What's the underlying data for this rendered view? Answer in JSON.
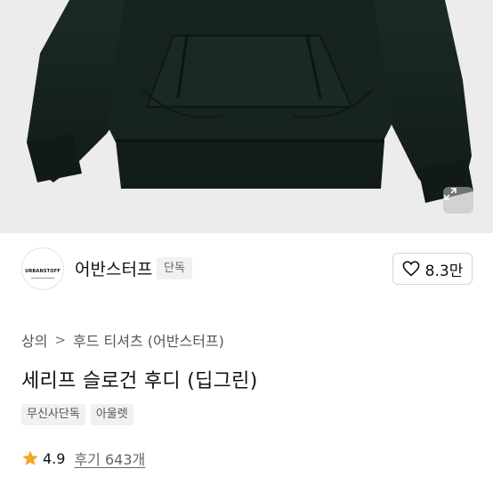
{
  "hero": {
    "background": "#ececec",
    "garment_color": "#17241f",
    "expand_icon": "expand-arrows-icon"
  },
  "brand": {
    "logo_text": "URBANSTOFF",
    "name": "어반스터프",
    "badge": "단독",
    "like_icon": "heart-outline-icon",
    "like_count": "8.3만"
  },
  "breadcrumb": {
    "items": [
      "상의",
      "후드 티셔츠 (어반스터프)"
    ],
    "separator": ">"
  },
  "product": {
    "title": "세리프 슬로건 후디 (딥그린)"
  },
  "tags": [
    "무신사단독",
    "아울렛"
  ],
  "rating": {
    "icon": "star-icon",
    "star_color": "#f5a623",
    "value": "4.9",
    "review_label": "후기 643개"
  }
}
